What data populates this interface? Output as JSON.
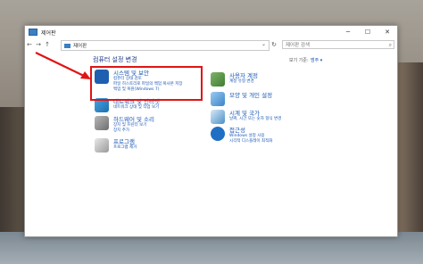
{
  "window": {
    "title": "제어판",
    "controls": [
      "─",
      "☐",
      "✕"
    ]
  },
  "address": {
    "path": "제어판",
    "search_placeholder": "제어판 검색"
  },
  "main": {
    "heading": "컴퓨터 설정 변경",
    "view_by_label": "보기 기준:",
    "view_by_value": "범주 ▾",
    "left_categories": [
      {
        "title": "시스템 및 보안",
        "links": [
          "컴퓨터 상태 검토",
          "파일 히스토리로 파일의 백업 복사본 저장",
          "백업 및 복원(Windows 7)"
        ]
      },
      {
        "title": "네트워크 및 인터넷",
        "links": [
          "네트워크 상태 및 작업 보기"
        ]
      },
      {
        "title": "하드웨어 및 소리",
        "links": [
          "장치 및 프린터 보기",
          "장치 추가"
        ]
      },
      {
        "title": "프로그램",
        "links": [
          "프로그램 제거"
        ]
      }
    ],
    "right_categories": [
      {
        "title": "사용자 계정",
        "links": [
          "계정 유형 변경"
        ]
      },
      {
        "title": "모양 및 개인 설정",
        "links": []
      },
      {
        "title": "시계 및 국가",
        "links": [
          "날짜, 시간 또는 숫자 형식 변경"
        ]
      },
      {
        "title": "접근성",
        "links": [
          "Windows 설정 사용",
          "시각적 디스플레이 최적화"
        ]
      }
    ]
  },
  "colors": {
    "link": "#1a56b5",
    "highlight": "#e01414"
  }
}
